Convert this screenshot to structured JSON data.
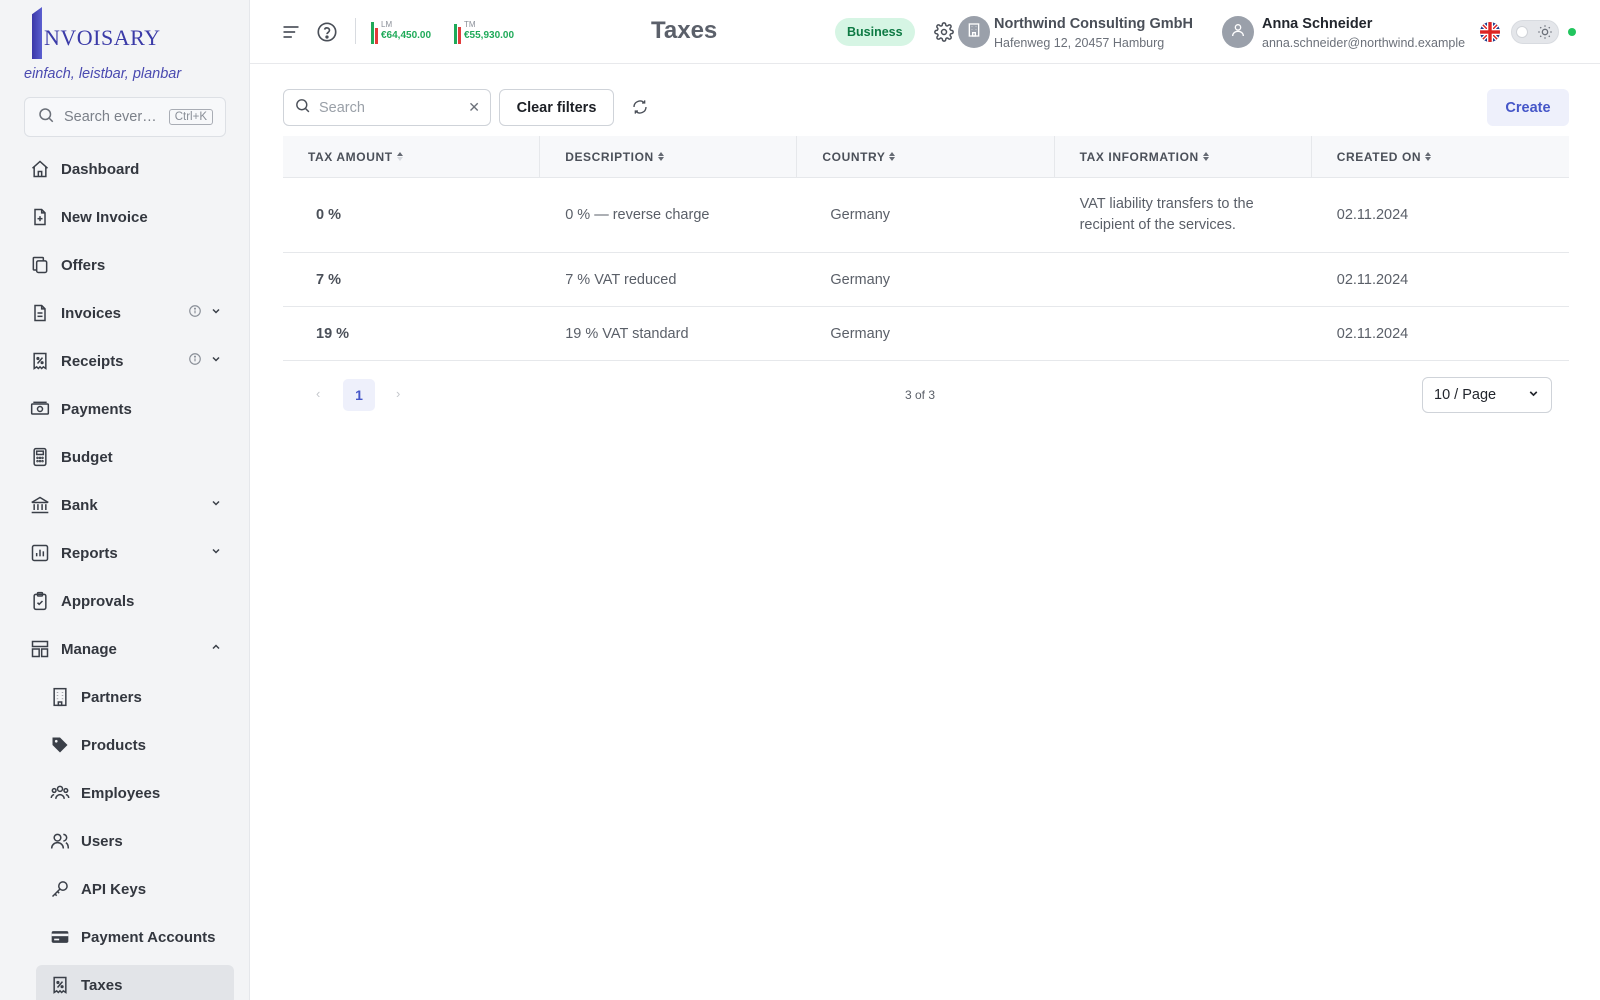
{
  "brand": {
    "logo_text": "NVOISARY",
    "tagline": "einfach, leistbar, planbar"
  },
  "sidebar": {
    "search_placeholder": "Search ever…",
    "search_shortcut": "Ctrl+K",
    "items": [
      {
        "label": "Dashboard",
        "icon": "home-icon"
      },
      {
        "label": "New Invoice",
        "icon": "file-plus-icon"
      },
      {
        "label": "Offers",
        "icon": "copy-icon"
      },
      {
        "label": "Invoices",
        "icon": "file-text-icon"
      },
      {
        "label": "Receipts",
        "icon": "receipt-icon"
      },
      {
        "label": "Payments",
        "icon": "banknote-icon"
      },
      {
        "label": "Budget",
        "icon": "calculator-icon"
      },
      {
        "label": "Bank",
        "icon": "bank-icon"
      },
      {
        "label": "Reports",
        "icon": "bar-chart-icon"
      },
      {
        "label": "Approvals",
        "icon": "clipboard-check-icon"
      },
      {
        "label": "Manage",
        "icon": "layout-icon"
      }
    ],
    "sub_items": [
      {
        "label": "Partners",
        "icon": "building-icon"
      },
      {
        "label": "Products",
        "icon": "tag-icon"
      },
      {
        "label": "Employees",
        "icon": "users-group-icon"
      },
      {
        "label": "Users",
        "icon": "users-icon"
      },
      {
        "label": "API Keys",
        "icon": "key-icon"
      },
      {
        "label": "Payment Accounts",
        "icon": "credit-card-icon"
      },
      {
        "label": "Taxes",
        "icon": "receipt-percent-icon"
      }
    ]
  },
  "header": {
    "stats": [
      {
        "key": "LM",
        "value": "€64,450.00"
      },
      {
        "key": "TM",
        "value": "€55,930.00"
      }
    ],
    "title": "Taxes",
    "plan_badge": "Business",
    "org": {
      "name": "Northwind Consulting GmbH",
      "address": "Hafenweg 12, 20457 Hamburg"
    },
    "user": {
      "name": "Anna Schneider",
      "email": "anna.schneider@northwind.example"
    },
    "colors": {
      "stat_green": "#1faa59",
      "stat_red": "#e23b3b",
      "accent": "#4556c8"
    }
  },
  "toolbar": {
    "search_placeholder": "Search",
    "clear_filters_label": "Clear filters",
    "create_label": "Create"
  },
  "table": {
    "columns": [
      "TAX AMOUNT",
      "DESCRIPTION",
      "COUNTRY",
      "TAX INFORMATION",
      "CREATED ON"
    ],
    "rows": [
      {
        "amount": "0 %",
        "description": "0 % — reverse charge",
        "country": "Germany",
        "info": "VAT liability transfers to the recipient of the services.",
        "created": "02.11.2024"
      },
      {
        "amount": "7 %",
        "description": "7 % VAT reduced",
        "country": "Germany",
        "info": "",
        "created": "02.11.2024"
      },
      {
        "amount": "19 %",
        "description": "19 % VAT standard",
        "country": "Germany",
        "info": "",
        "created": "02.11.2024"
      }
    ]
  },
  "pagination": {
    "current_page": "1",
    "count": "3 of 3",
    "page_size": "10 / Page"
  }
}
